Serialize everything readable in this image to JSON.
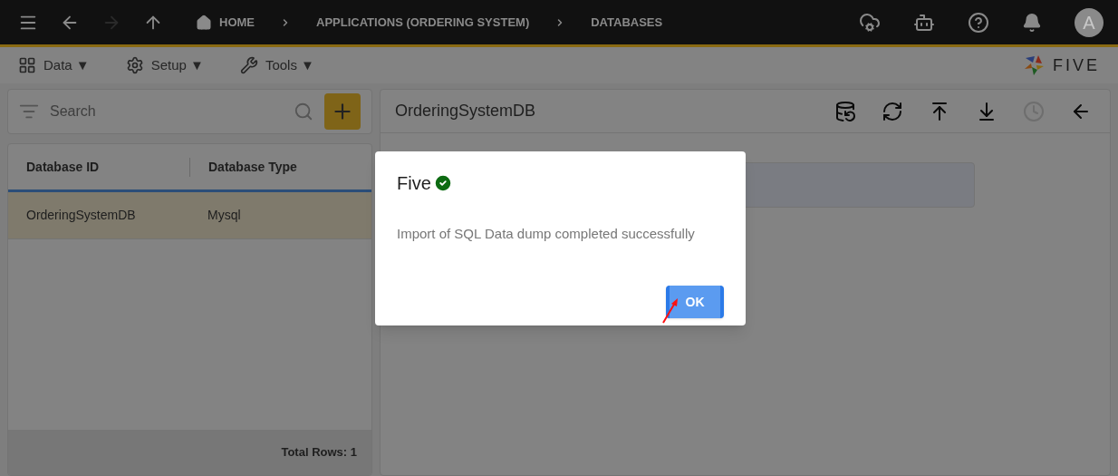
{
  "topbar": {
    "nav": [
      {
        "kind": "menu",
        "disabled": false
      },
      {
        "kind": "back",
        "disabled": false
      },
      {
        "kind": "forward",
        "disabled": true
      },
      {
        "kind": "up",
        "disabled": false
      }
    ],
    "breadcrumbs": [
      "HOME",
      "APPLICATIONS (ORDERING SYSTEM)",
      "DATABASES"
    ],
    "avatar": "A"
  },
  "menubar": [
    {
      "kind": "data",
      "label": "Data ▼"
    },
    {
      "kind": "setup",
      "label": "Setup ▼"
    },
    {
      "kind": "tools",
      "label": "Tools ▼"
    }
  ],
  "logo": "FIVE",
  "search": {
    "placeholder": "Search"
  },
  "table": {
    "columns": [
      "Database ID",
      "Database Type"
    ],
    "rows": [
      {
        "cells": [
          "OrderingSystemDB",
          "Mysql"
        ],
        "selected": true
      }
    ],
    "footer": "Total Rows: 1"
  },
  "detail": {
    "title": "OrderingSystemDB",
    "actions": [
      {
        "kind": "add-db",
        "disabled": false
      },
      {
        "kind": "sync",
        "disabled": false
      },
      {
        "kind": "upload",
        "disabled": false
      },
      {
        "kind": "download",
        "disabled": false
      },
      {
        "kind": "history",
        "disabled": true
      },
      {
        "kind": "back",
        "disabled": false
      }
    ]
  },
  "dialog": {
    "title": "Five",
    "message": "Import of SQL Data dump completed successfully",
    "button": "OK"
  }
}
